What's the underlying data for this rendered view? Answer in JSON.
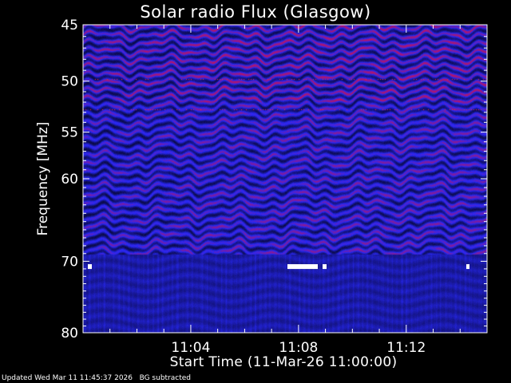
{
  "chart_data": {
    "type": "heatmap",
    "title": "Solar radio Flux (Glasgow)",
    "ylabel": "Frequency [MHz]",
    "xlabel": "Start Time (11-Mar-26 11:00:00)",
    "y_ticks": [
      45,
      50,
      55,
      60,
      70,
      80
    ],
    "y_range": [
      45,
      80
    ],
    "x_ticks": [
      "11:04",
      "11:08",
      "11:12"
    ],
    "x_range_minutes_after_start": [
      0,
      15
    ],
    "colors": {
      "background": "#000000",
      "low": "#2a2ac8",
      "high": "#ff1a1a",
      "saturated": "#ffffff"
    }
  },
  "footer": "Updated Wed Mar 11 11:45:37 2026   BG subtracted"
}
